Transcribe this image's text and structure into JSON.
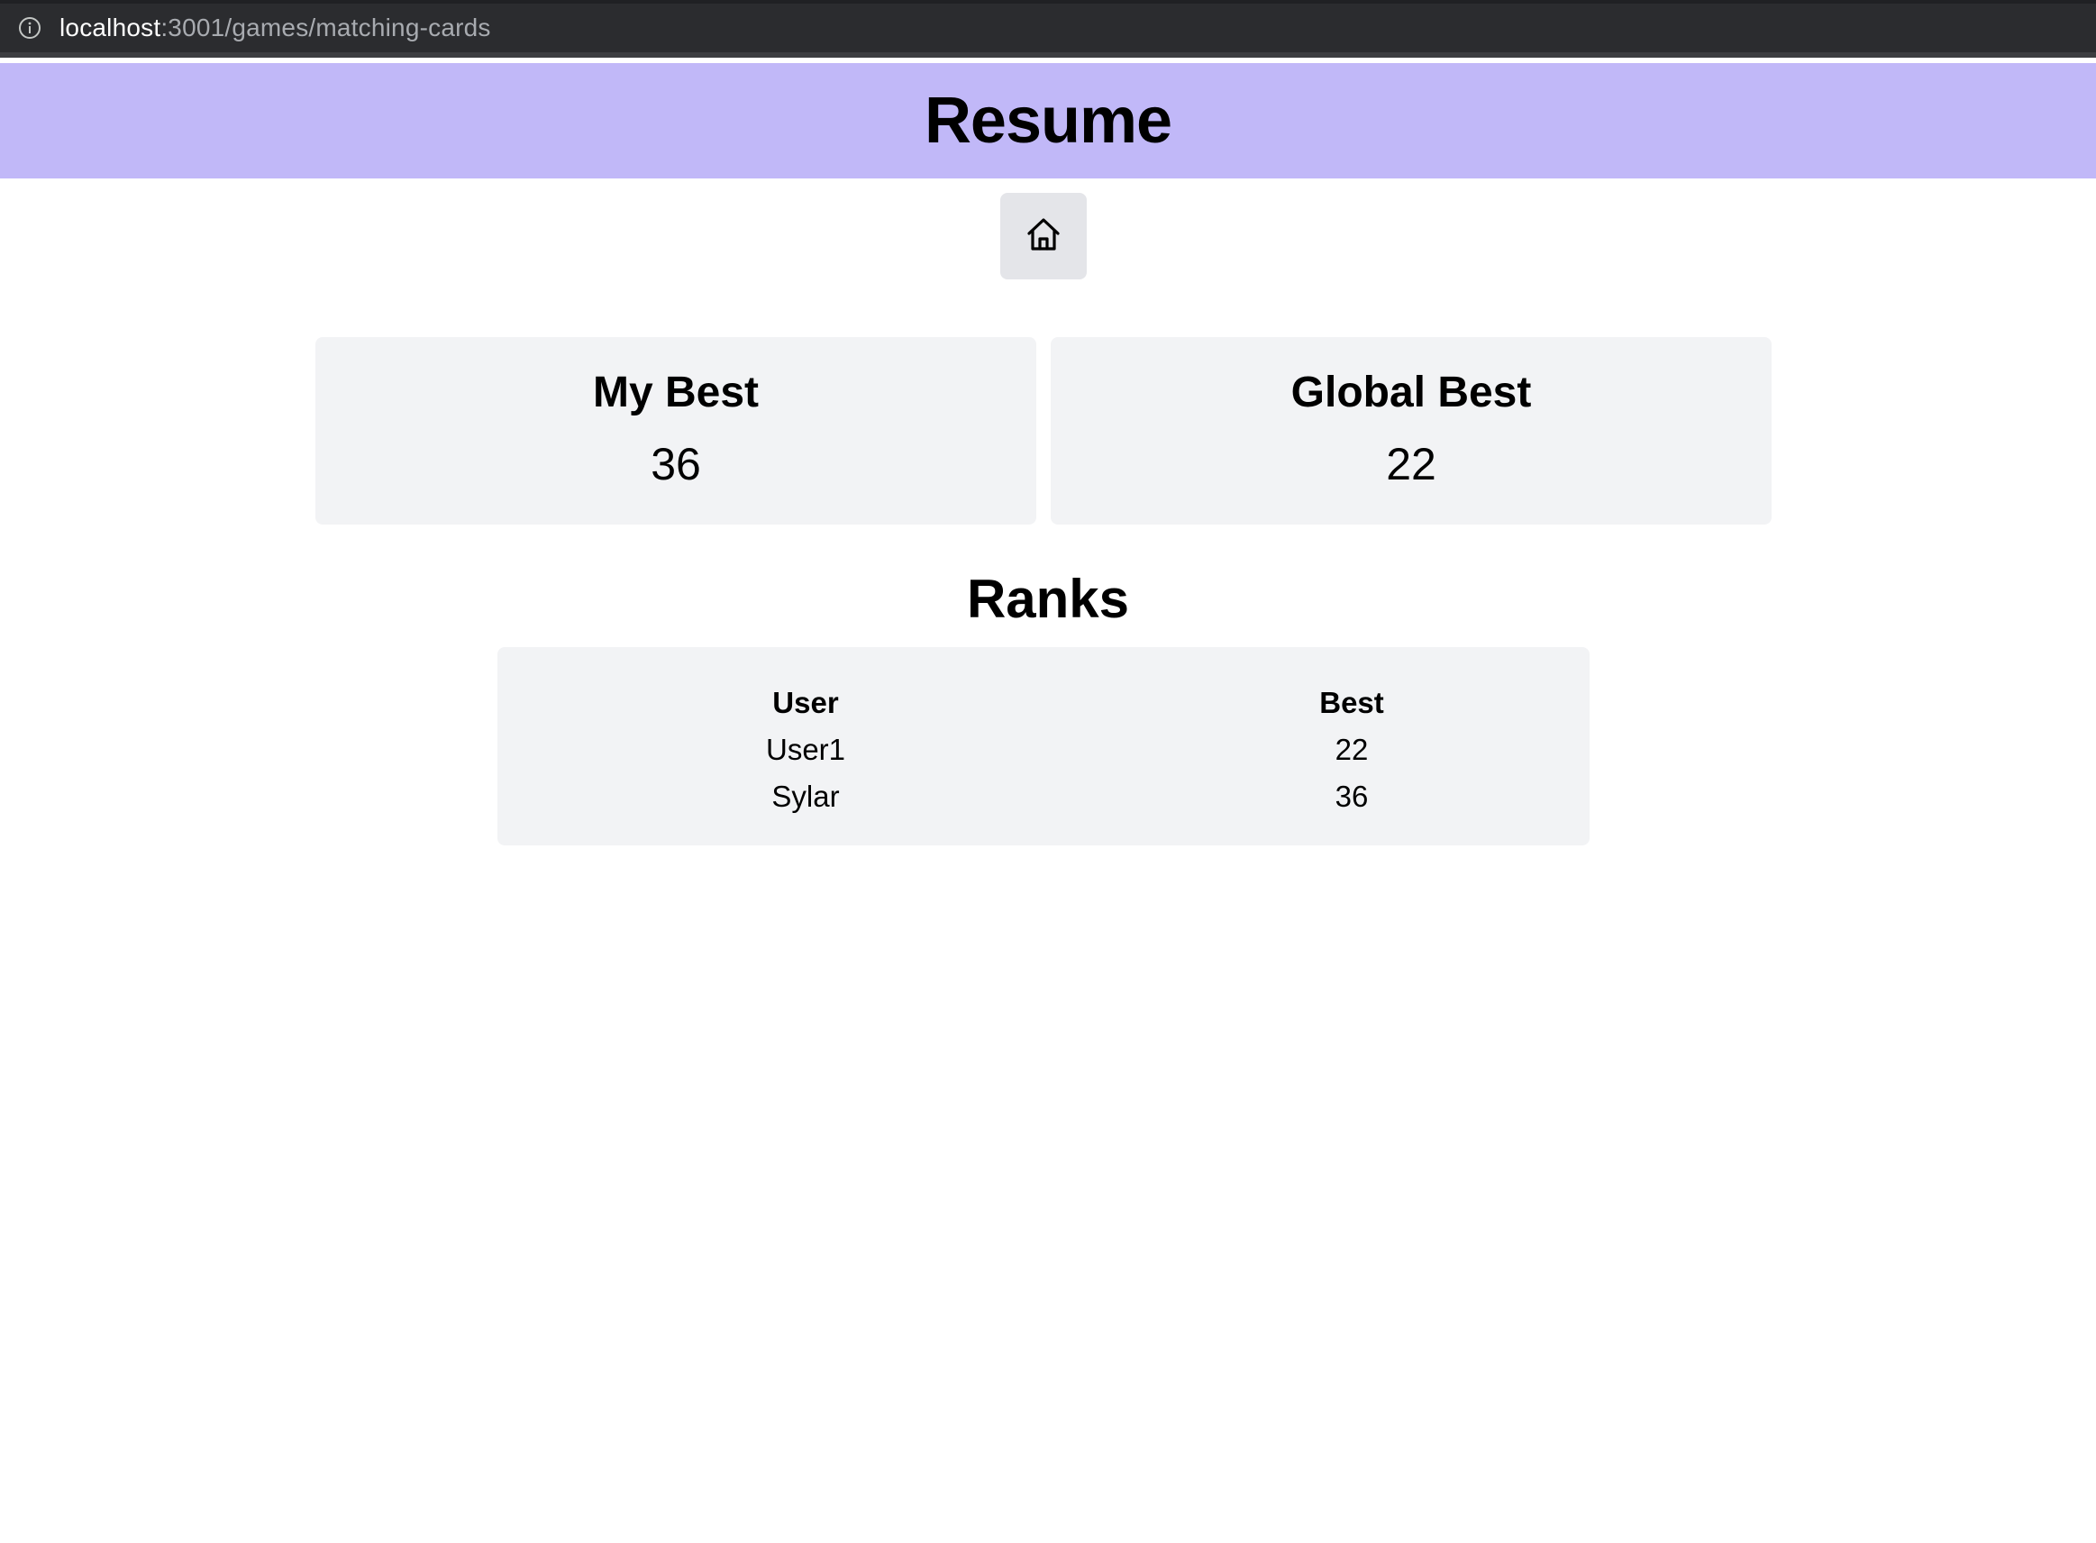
{
  "browser": {
    "url_host": "localhost",
    "url_path": ":3001/games/matching-cards",
    "info_icon": "info-icon"
  },
  "header": {
    "title": "Resume"
  },
  "nav": {
    "home_icon": "home-icon"
  },
  "stats": {
    "my_best": {
      "label": "My Best",
      "value": "36"
    },
    "global_best": {
      "label": "Global Best",
      "value": "22"
    }
  },
  "ranks": {
    "title": "Ranks",
    "columns": [
      "User",
      "Best"
    ],
    "rows": [
      {
        "user": "User1",
        "best": "22"
      },
      {
        "user": "Sylar",
        "best": "36"
      }
    ]
  },
  "colors": {
    "banner": "#c1b8f8",
    "card_bg": "#f2f3f5",
    "button_bg": "#e4e5e9",
    "address_bar": "#202124"
  }
}
